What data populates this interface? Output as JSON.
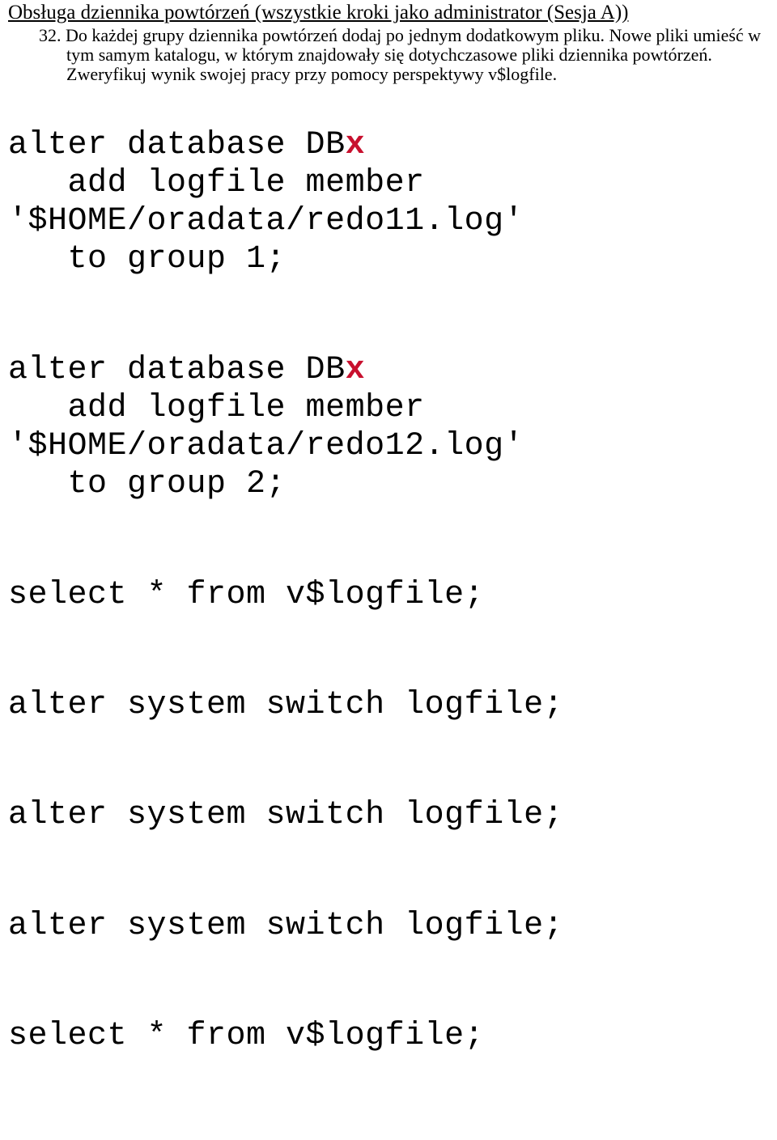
{
  "title": "Obsługa dziennika powtórzeń (wszystkie kroki jako administrator (Sesja A))",
  "instruction": {
    "number": "32.",
    "text": "Do każdej grupy dziennika powtórzeń dodaj po jednym dodatkowym pliku. Nowe pliki umieść w tym samym katalogu, w którym znajdowały się dotychczasowe pliki dziennika powtórzeń. Zweryfikuj wynik swojej pracy przy pomocy perspektywy v$logfile."
  },
  "code": {
    "block1": {
      "l1a": "alter database DB",
      "l1b": "x",
      "l2": "   add logfile member",
      "l3": "'$HOME/oradata/redo11.log'",
      "l4": "   to group 1;"
    },
    "block2": {
      "l1a": "alter database DB",
      "l1b": "x",
      "l2": "   add logfile member",
      "l3": "'$HOME/oradata/redo12.log'",
      "l4": "   to group 2;"
    },
    "block3": "select * from v$logfile;",
    "block4": "alter system switch logfile;",
    "block5": "alter system switch logfile;",
    "block6": "alter system switch logfile;",
    "block7": "select * from v$logfile;"
  }
}
